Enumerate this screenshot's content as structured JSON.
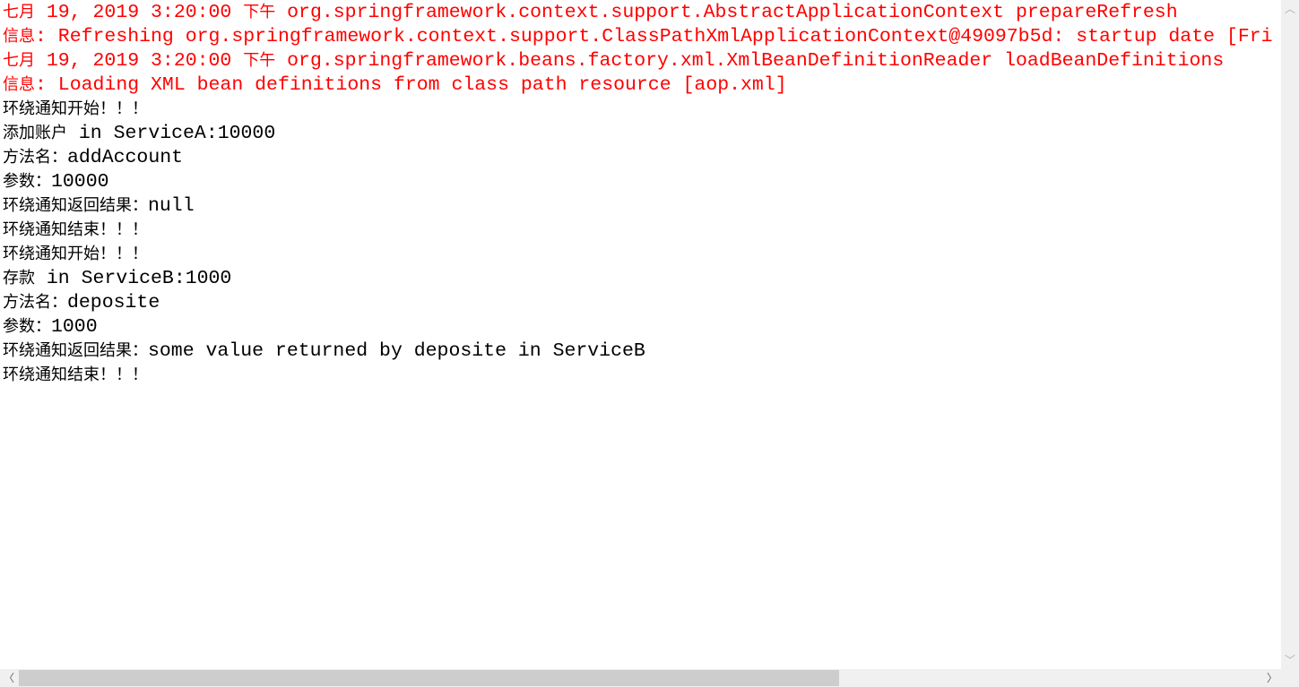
{
  "console": {
    "colors": {
      "stderr": "#ff0000",
      "stdout": "#000000"
    },
    "lines": [
      {
        "stream": "err",
        "segments": [
          {
            "t": "七月",
            "cjk": true
          },
          {
            "t": " 19, 2019 3:20:00 "
          },
          {
            "t": "下午",
            "cjk": true
          },
          {
            "t": " org.springframework.context.support.AbstractApplicationContext prepareRefresh"
          }
        ]
      },
      {
        "stream": "err",
        "segments": [
          {
            "t": "信息",
            "cjk": true
          },
          {
            "t": ": Refreshing org.springframework.context.support.ClassPathXmlApplicationContext@49097b5d: startup date [Fri"
          }
        ]
      },
      {
        "stream": "err",
        "segments": [
          {
            "t": "七月",
            "cjk": true
          },
          {
            "t": " 19, 2019 3:20:00 "
          },
          {
            "t": "下午",
            "cjk": true
          },
          {
            "t": " org.springframework.beans.factory.xml.XmlBeanDefinitionReader loadBeanDefinitions"
          }
        ]
      },
      {
        "stream": "err",
        "segments": [
          {
            "t": "信息",
            "cjk": true
          },
          {
            "t": ": Loading XML bean definitions from class path resource [aop.xml]"
          }
        ]
      },
      {
        "stream": "out",
        "segments": [
          {
            "t": "环绕通知开始！！！",
            "cjk": true
          }
        ]
      },
      {
        "stream": "out",
        "segments": [
          {
            "t": "添加账户",
            "cjk": true
          },
          {
            "t": " in ServiceA:10000"
          }
        ]
      },
      {
        "stream": "out",
        "segments": [
          {
            "t": "方法名：",
            "cjk": true
          },
          {
            "t": "addAccount"
          }
        ]
      },
      {
        "stream": "out",
        "segments": [
          {
            "t": "参数：",
            "cjk": true
          },
          {
            "t": "10000"
          }
        ]
      },
      {
        "stream": "out",
        "segments": [
          {
            "t": "环绕通知返回结果：",
            "cjk": true
          },
          {
            "t": "null"
          }
        ]
      },
      {
        "stream": "out",
        "segments": [
          {
            "t": "环绕通知结束！！！",
            "cjk": true
          }
        ]
      },
      {
        "stream": "out",
        "segments": [
          {
            "t": "环绕通知开始！！！",
            "cjk": true
          }
        ]
      },
      {
        "stream": "out",
        "segments": [
          {
            "t": "存款",
            "cjk": true
          },
          {
            "t": " in ServiceB:1000"
          }
        ]
      },
      {
        "stream": "out",
        "segments": [
          {
            "t": "方法名：",
            "cjk": true
          },
          {
            "t": "deposite"
          }
        ]
      },
      {
        "stream": "out",
        "segments": [
          {
            "t": "参数：",
            "cjk": true
          },
          {
            "t": "1000"
          }
        ]
      },
      {
        "stream": "out",
        "segments": [
          {
            "t": "环绕通知返回结果：",
            "cjk": true
          },
          {
            "t": "some value returned by deposite in ServiceB"
          }
        ]
      },
      {
        "stream": "out",
        "segments": [
          {
            "t": "环绕通知结束！！！",
            "cjk": true
          }
        ]
      }
    ]
  },
  "scrollbars": {
    "horizontal_visible_fraction": 0.66,
    "horizontal_position": 0,
    "icons": {
      "up": "chevron-up-icon",
      "down": "chevron-down-icon",
      "left": "chevron-left-icon",
      "right": "chevron-right-icon"
    }
  }
}
